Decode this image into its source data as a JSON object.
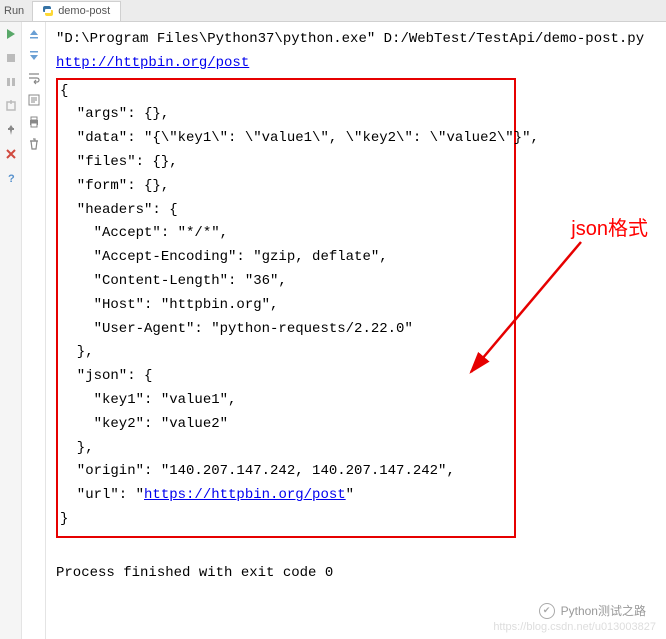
{
  "tab": {
    "run_label": "Run",
    "title": "demo-post"
  },
  "console": {
    "command": "\"D:\\Program Files\\Python37\\python.exe\" D:/WebTest/TestApi/demo-post.py",
    "url": "http://httpbin.org/post",
    "json_open": "{",
    "json_lines": {
      "args": "  \"args\": {},",
      "data": "  \"data\": \"{\\\"key1\\\": \\\"value1\\\", \\\"key2\\\": \\\"value2\\\"}\",",
      "files": "  \"files\": {},",
      "form": "  \"form\": {},",
      "headers_open": "  \"headers\": {",
      "accept": "    \"Accept\": \"*/*\",",
      "accept_encoding": "    \"Accept-Encoding\": \"gzip, deflate\",",
      "content_length": "    \"Content-Length\": \"36\",",
      "host": "    \"Host\": \"httpbin.org\",",
      "user_agent": "    \"User-Agent\": \"python-requests/2.22.0\"",
      "headers_close": "  },",
      "json_open2": "  \"json\": {",
      "key1": "    \"key1\": \"value1\",",
      "key2": "    \"key2\": \"value2\"",
      "json_close2": "  },",
      "origin": "  \"origin\": \"140.207.147.242, 140.207.147.242\",",
      "url_prefix": "  \"url\": \"",
      "url_link": "https://httpbin.org/post",
      "url_suffix": "\""
    },
    "json_close": "}",
    "exit_msg": "Process finished with exit code 0"
  },
  "annotation": {
    "label": "json格式"
  },
  "watermark": {
    "logo_text": "Python测试之路",
    "url_text": "https://blog.csdn.net/u013003827"
  }
}
